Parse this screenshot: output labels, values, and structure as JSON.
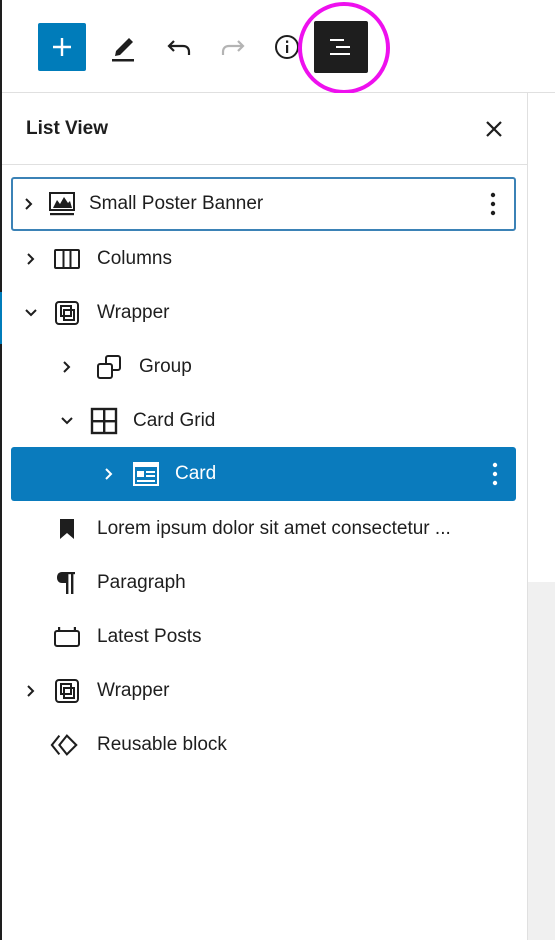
{
  "colors": {
    "accent": "#007cba",
    "selected": "#0a7bbd",
    "highlight_ring": "#ee10ee",
    "dark": "#1e1e1e"
  },
  "toolbar": {
    "buttons": [
      {
        "name": "add-block-button",
        "icon": "plus-icon"
      },
      {
        "name": "edit-tool-button",
        "icon": "pencil-icon"
      },
      {
        "name": "undo-button",
        "icon": "undo-icon"
      },
      {
        "name": "redo-button",
        "icon": "redo-icon",
        "disabled": true
      },
      {
        "name": "details-button",
        "icon": "info-icon"
      },
      {
        "name": "list-view-button",
        "icon": "list-view-icon",
        "pressed": true
      }
    ]
  },
  "panel": {
    "title": "List View",
    "close_icon": "close-icon",
    "items": [
      {
        "label": "Small Poster Banner",
        "icon": "cover-icon",
        "expandable": true,
        "expanded": false,
        "depth": 0,
        "has_options": true,
        "state": "focused"
      },
      {
        "label": "Columns",
        "icon": "columns-icon",
        "expandable": true,
        "expanded": false,
        "depth": 0
      },
      {
        "label": "Wrapper",
        "icon": "reusable-wrapper-icon",
        "expandable": true,
        "expanded": true,
        "depth": 0
      },
      {
        "label": "Group",
        "icon": "group-icon",
        "expandable": true,
        "expanded": false,
        "depth": 1
      },
      {
        "label": "Card Grid",
        "icon": "grid-icon",
        "expandable": true,
        "expanded": true,
        "depth": 1
      },
      {
        "label": "Card",
        "icon": "card-icon",
        "expandable": true,
        "expanded": false,
        "depth": 2,
        "has_options": true,
        "state": "selected"
      },
      {
        "label": "Lorem ipsum dolor sit amet consectetur ...",
        "icon": "bookmark-icon",
        "expandable": false,
        "depth": 0
      },
      {
        "label": "Paragraph",
        "icon": "paragraph-icon",
        "expandable": false,
        "depth": 0
      },
      {
        "label": "Latest Posts",
        "icon": "latest-posts-icon",
        "expandable": false,
        "depth": 0
      },
      {
        "label": "Wrapper",
        "icon": "reusable-wrapper-icon",
        "expandable": true,
        "expanded": false,
        "depth": 0
      },
      {
        "label": "Reusable block",
        "icon": "reusable-block-icon",
        "expandable": false,
        "depth": 0
      }
    ]
  }
}
